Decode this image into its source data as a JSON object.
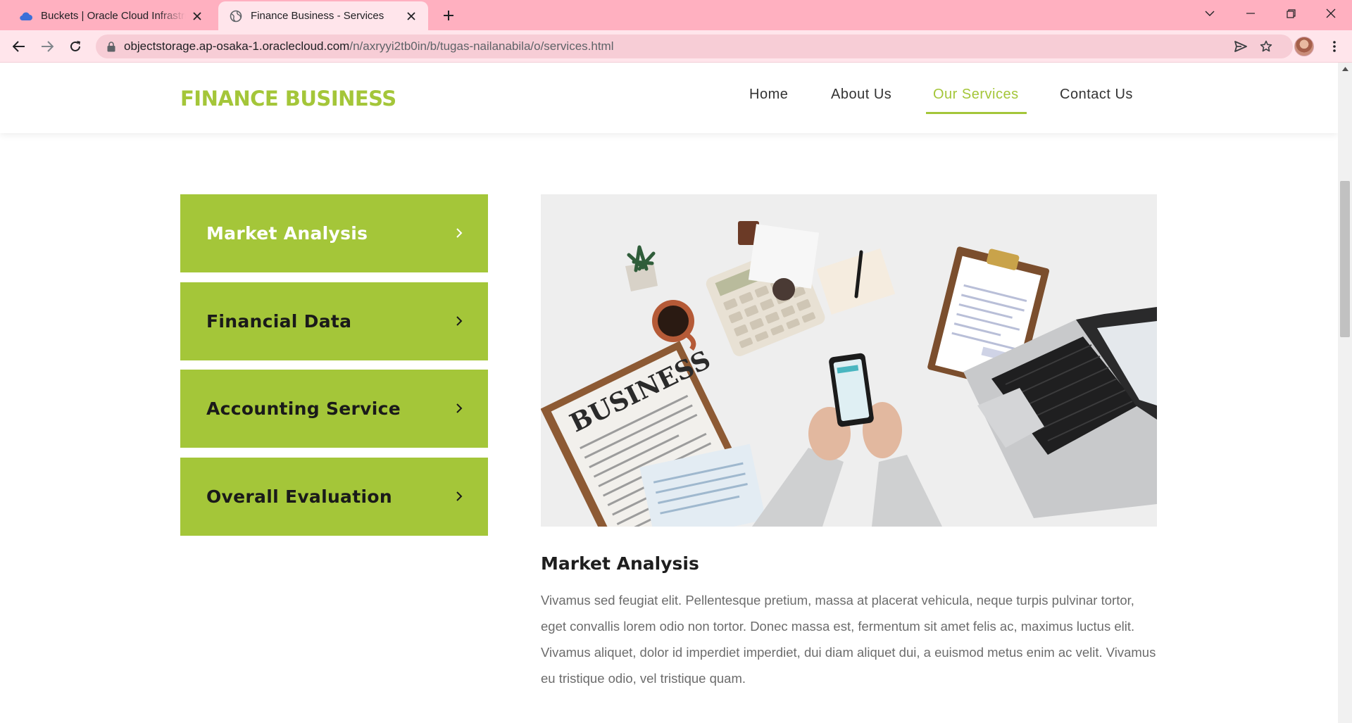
{
  "browser": {
    "tabs": [
      {
        "title": "Buckets | Oracle Cloud Infrastructure",
        "icon": "cloud-icon",
        "active": false
      },
      {
        "title": "Finance Business - Services",
        "icon": "globe-icon",
        "active": true
      }
    ],
    "url_host": "objectstorage.ap-osaka-1.oraclecloud.com",
    "url_path": "/n/axryyi2tb0in/b/tugas-nailanabila/o/services.html"
  },
  "site": {
    "logo": "FINANCE BUSINESS",
    "nav": [
      {
        "label": "Home",
        "active": false
      },
      {
        "label": "About Us",
        "active": false
      },
      {
        "label": "Our Services",
        "active": true
      },
      {
        "label": "Contact Us",
        "active": false
      }
    ]
  },
  "services": {
    "menu": [
      {
        "label": "Market Analysis",
        "active": true
      },
      {
        "label": "Financial Data",
        "active": false
      },
      {
        "label": "Accounting Service",
        "active": false
      },
      {
        "label": "Overall Evaluation",
        "active": false
      }
    ],
    "detail_title": "Market Analysis",
    "detail_text": "Vivamus sed feugiat elit. Pellentesque pretium, massa at placerat vehicula, neque turpis pulvinar tortor, eget convallis lorem odio non tortor. Donec massa est, fermentum sit amet felis ac, maximus luctus elit. Vivamus aliquet, dolor id imperdiet imperdiet, dui diam aliquet dui, a euismod metus enim ac velit. Vivamus eu tristique odio, vel tristique quam.",
    "newspaper_headline": "BUSINESS"
  },
  "colors": {
    "accent": "#a4c639",
    "tabbar": "#ffb0c0",
    "toolbar": "#ffe5eb"
  }
}
